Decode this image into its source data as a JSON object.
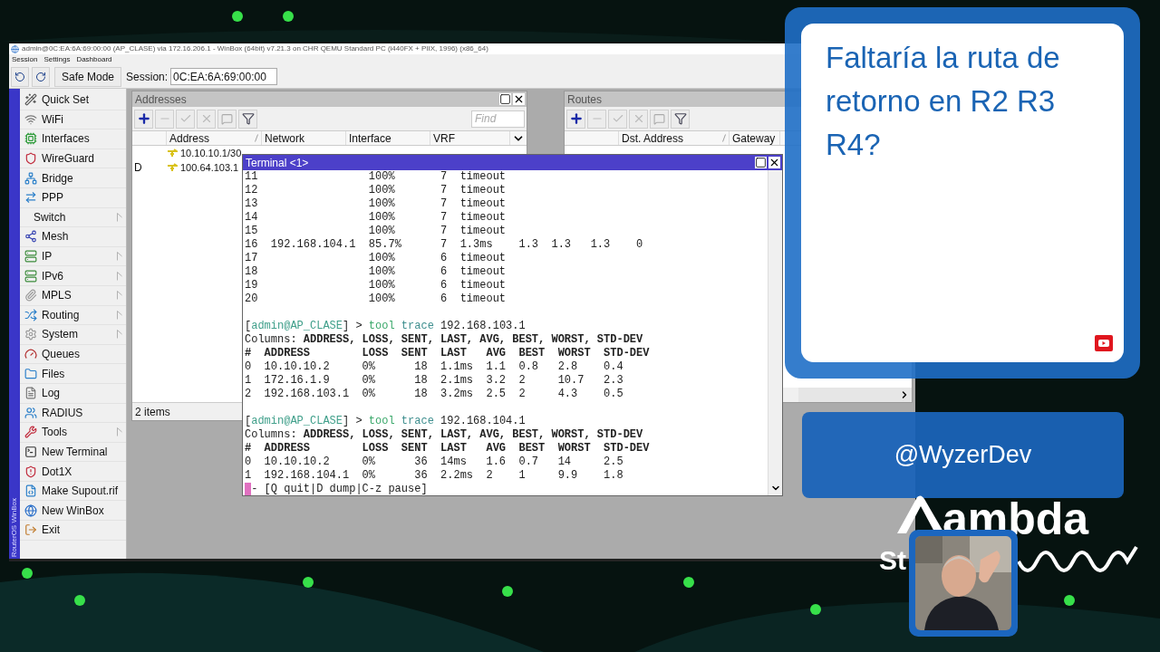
{
  "window": {
    "title": "admin@0C:EA:6A:69:00:00 (AP_CLASE) via 172.16.206.1 - WinBox (64bit) v7.21.3 on CHR QEMU Standard PC (i440FX + PIIX, 1996) (x86_64)"
  },
  "menu": [
    "Session",
    "Settings",
    "Dashboard"
  ],
  "toolbar": {
    "safe_mode": "Safe Mode",
    "session_label": "Session:",
    "session_value": "0C:EA:6A:69:00:00"
  },
  "sidebar": {
    "brand": "RouterOS WinBox",
    "items": [
      {
        "label": "Quick Set",
        "submenu": false
      },
      {
        "label": "WiFi",
        "submenu": false
      },
      {
        "label": "Interfaces",
        "submenu": false
      },
      {
        "label": "WireGuard",
        "submenu": false
      },
      {
        "label": "Bridge",
        "submenu": false
      },
      {
        "label": "PPP",
        "submenu": false
      },
      {
        "label": "Switch",
        "submenu": true
      },
      {
        "label": "Mesh",
        "submenu": false
      },
      {
        "label": "IP",
        "submenu": true
      },
      {
        "label": "IPv6",
        "submenu": true
      },
      {
        "label": "MPLS",
        "submenu": true
      },
      {
        "label": "Routing",
        "submenu": true
      },
      {
        "label": "System",
        "submenu": true
      },
      {
        "label": "Queues",
        "submenu": false
      },
      {
        "label": "Files",
        "submenu": false
      },
      {
        "label": "Log",
        "submenu": false
      },
      {
        "label": "RADIUS",
        "submenu": false
      },
      {
        "label": "Tools",
        "submenu": true
      },
      {
        "label": "New Terminal",
        "submenu": false
      },
      {
        "label": "Dot1X",
        "submenu": false
      },
      {
        "label": "Make Supout.rif",
        "submenu": false
      },
      {
        "label": "New WinBox",
        "submenu": false
      },
      {
        "label": "Exit",
        "submenu": false
      }
    ]
  },
  "addresses": {
    "title": "Addresses",
    "find_placeholder": "Find",
    "columns": [
      "Address",
      "Network",
      "Interface",
      "VRF"
    ],
    "rows": [
      {
        "address": "10.10.10.1/30"
      },
      {
        "flag": "D",
        "address": "100.64.103.1"
      }
    ],
    "status": "2 items"
  },
  "routes": {
    "title": "Routes",
    "columns": [
      "Dst. Address",
      "Gateway"
    ]
  },
  "terminal": {
    "title": "Terminal <1>",
    "lines": [
      {
        "kind": "row",
        "text": "11                 100%       7  timeout"
      },
      {
        "kind": "row",
        "text": "12                 100%       7  timeout"
      },
      {
        "kind": "row",
        "text": "13                 100%       7  timeout"
      },
      {
        "kind": "row",
        "text": "14                 100%       7  timeout"
      },
      {
        "kind": "row",
        "text": "15                 100%       7  timeout"
      },
      {
        "kind": "row",
        "text": "16  192.168.104.1  85.7%      7  1.3ms    1.3  1.3   1.3    0"
      },
      {
        "kind": "row",
        "text": "17                 100%       6  timeout"
      },
      {
        "kind": "row",
        "text": "18                 100%       6  timeout"
      },
      {
        "kind": "row",
        "text": "19                 100%       6  timeout"
      },
      {
        "kind": "row",
        "text": "20                 100%       6  timeout"
      },
      {
        "kind": "blank"
      },
      {
        "kind": "prompt",
        "segments": [
          {
            "text": "[",
            "color": "#222222"
          },
          {
            "text": "admin@AP_CLASE",
            "color": "#3f9f8a"
          },
          {
            "text": "] > ",
            "color": "#222222"
          },
          {
            "text": "tool ",
            "color": "#3aa86a"
          },
          {
            "text": "trace",
            "color": "#3f8f8f"
          },
          {
            "text": " 192.168.103.1",
            "color": "#222222"
          }
        ]
      },
      {
        "kind": "columns",
        "text": "Columns: **ADDRESS, LOSS, SENT, LAST, AVG, BEST, WORST, STD-DEV**"
      },
      {
        "kind": "header",
        "text": "#  ADDRESS        LOSS  SENT  LAST   AVG  BEST  WORST  STD-DEV"
      },
      {
        "kind": "row",
        "text": "0  10.10.10.2     0%      18  1.1ms  1.1  0.8   2.8    0.4"
      },
      {
        "kind": "row",
        "text": "1  172.16.1.9     0%      18  2.1ms  3.2  2     10.7   2.3"
      },
      {
        "kind": "row",
        "text": "2  192.168.103.1  0%      18  3.2ms  2.5  2     4.3    0.5"
      },
      {
        "kind": "blank"
      },
      {
        "kind": "prompt",
        "segments": [
          {
            "text": "[",
            "color": "#222222"
          },
          {
            "text": "admin@AP_CLASE",
            "color": "#3f9f8a"
          },
          {
            "text": "] > ",
            "color": "#222222"
          },
          {
            "text": "tool ",
            "color": "#3aa86a"
          },
          {
            "text": "trace",
            "color": "#3f8f8f"
          },
          {
            "text": " 192.168.104.1",
            "color": "#222222"
          }
        ]
      },
      {
        "kind": "columns",
        "text": "Columns: **ADDRESS, LOSS, SENT, LAST, AVG, BEST, WORST, STD-DEV**"
      },
      {
        "kind": "header",
        "text": "#  ADDRESS        LOSS  SENT  LAST   AVG  BEST  WORST  STD-DEV"
      },
      {
        "kind": "row",
        "text": "0  10.10.10.2     0%      36  14ms   1.6  0.7   14     2.5"
      },
      {
        "kind": "row",
        "text": "1  192.168.104.1  0%      36  2.2ms  2    1     9.9    1.8"
      },
      {
        "kind": "status",
        "cursor": true,
        "text": "- [Q quit|D dump|C-z pause]"
      }
    ]
  },
  "overlay": {
    "comment": "Faltaría la ruta de retorno en R2 R3 R4?",
    "username": "@WyzerDev",
    "logo": {
      "text": "ambda",
      "subtext": "St"
    }
  }
}
